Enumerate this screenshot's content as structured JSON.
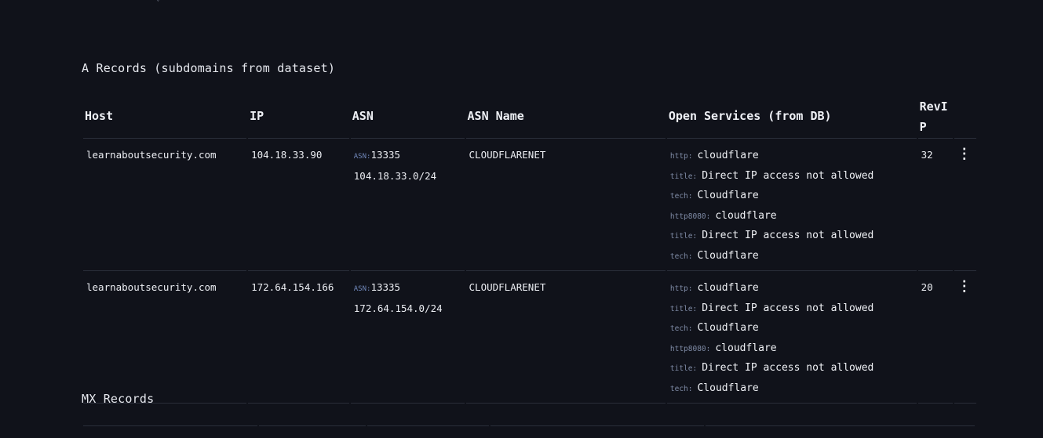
{
  "sections": {
    "a_records_title": "A Records (subdomains from dataset)",
    "mx_records_title": "MX Records"
  },
  "table": {
    "headers": {
      "host": "Host",
      "ip": "IP",
      "asn": "ASN",
      "asn_name": "ASN Name",
      "open_services": "Open Services (from DB)",
      "revip": "RevIP"
    },
    "rows": [
      {
        "host": "learnaboutsecurity.com",
        "ip": "104.18.33.90",
        "asn_label": "ASN:",
        "asn_number": "13335",
        "asn_prefix": "104.18.33.0/24",
        "asn_name": "CLOUDFLARENET",
        "services": [
          {
            "label": "http:",
            "value": "cloudflare"
          },
          {
            "label": "title:",
            "value": "Direct IP access not allowed"
          },
          {
            "label": "tech:",
            "value": "Cloudflare"
          },
          {
            "label": "http8080:",
            "value": "cloudflare"
          },
          {
            "label": "title:",
            "value": "Direct IP access not allowed"
          },
          {
            "label": "tech:",
            "value": "Cloudflare"
          }
        ],
        "revip": "32"
      },
      {
        "host": "learnaboutsecurity.com",
        "ip": "172.64.154.166",
        "asn_label": "ASN:",
        "asn_number": "13335",
        "asn_prefix": "172.64.154.0/24",
        "asn_name": "CLOUDFLARENET",
        "services": [
          {
            "label": "http:",
            "value": "cloudflare"
          },
          {
            "label": "title:",
            "value": "Direct IP access not allowed"
          },
          {
            "label": "tech:",
            "value": "Cloudflare"
          },
          {
            "label": "http8080:",
            "value": "cloudflare"
          },
          {
            "label": "title:",
            "value": "Direct IP access not allowed"
          },
          {
            "label": "tech:",
            "value": "Cloudflare"
          }
        ],
        "revip": "20"
      }
    ],
    "row_menu_icon": "kebab-menu-icon"
  },
  "colors": {
    "background": "#10121a",
    "divider": "#2a2e3a",
    "asn_label": "#6f86b8",
    "service_label": "#7f8ba6"
  }
}
